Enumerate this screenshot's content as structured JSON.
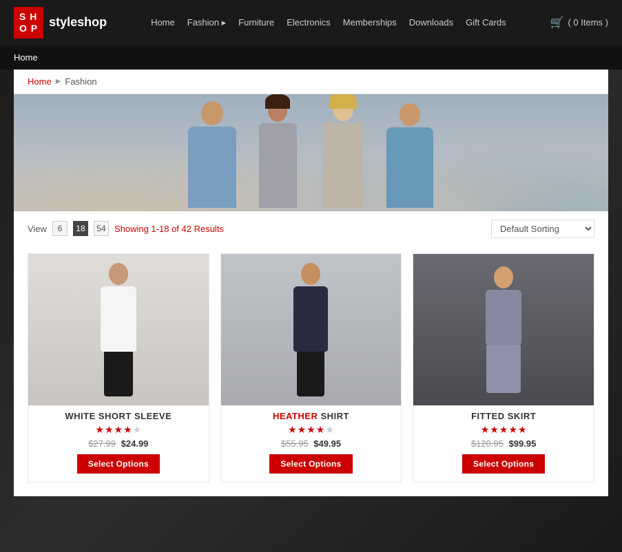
{
  "site": {
    "logo_line1": "S H",
    "logo_line2": "O P",
    "logo_name_regular": "style",
    "logo_name_bold": "shop"
  },
  "nav": {
    "home": "Home",
    "fashion": "Fashion",
    "fashion_arrow": "▸",
    "furniture": "Furniture",
    "electronics": "Electronics",
    "memberships": "Memberships",
    "downloads": "Downloads",
    "gift_cards": "Gift Cards",
    "cart_label": "( 0 Items )"
  },
  "page_title": "Home",
  "breadcrumb": {
    "home": "Home",
    "current": "Fashion"
  },
  "controls": {
    "view_label": "View",
    "view_6": "6",
    "view_18": "18",
    "view_54": "54",
    "results_text": "Showing 1-18 of 42 Results",
    "sort_default": "Default Sorting"
  },
  "products": [
    {
      "name_plain": "WHITE SHORT SLEEVE",
      "name_highlight": "WHITE",
      "name_rest": " SHORT SLEEVE",
      "stars_filled": 4,
      "stars_empty": 1,
      "old_price": "$27.99",
      "new_price": "$24.99",
      "btn_label": "Select Options",
      "image_class": "product-image-1",
      "figure_class": "figure-1"
    },
    {
      "name_plain": "HEATHER SHIRT",
      "name_highlight": "HEATHER",
      "name_rest": " SHIRT",
      "stars_filled": 4,
      "stars_empty": 1,
      "old_price": "$55.95",
      "new_price": "$49.95",
      "btn_label": "Select Options",
      "image_class": "product-image-2",
      "figure_class": "figure-2"
    },
    {
      "name_plain": "FITTED SKIRT",
      "name_highlight": "FITTED",
      "name_rest": " SKIRT",
      "stars_filled": 5,
      "stars_empty": 0,
      "old_price": "$120.95",
      "new_price": "$99.95",
      "btn_label": "Select Options",
      "image_class": "product-image-3",
      "figure_class": "figure-3"
    }
  ]
}
